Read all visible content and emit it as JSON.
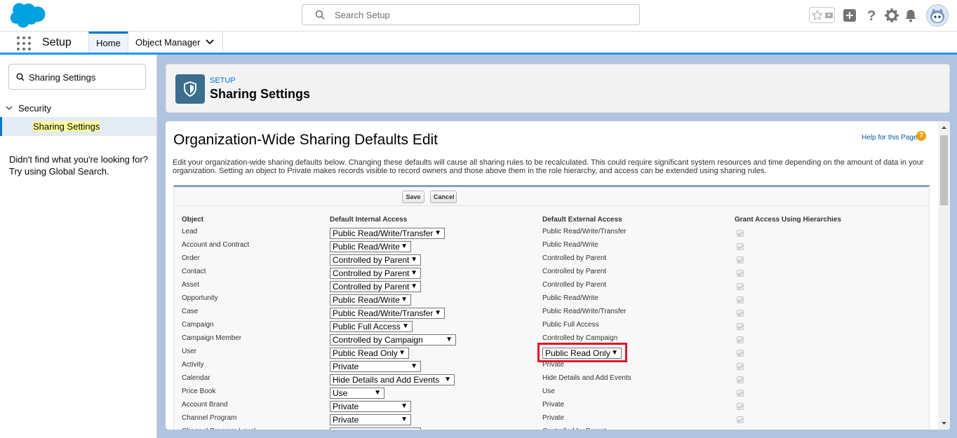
{
  "header": {
    "search_placeholder": "Search Setup",
    "icons": [
      "favorites-star-icon",
      "global-actions-plus-icon",
      "help-icon",
      "setup-gear-icon",
      "notifications-bell-icon",
      "user-avatar"
    ]
  },
  "nav": {
    "app_name": "Setup",
    "tabs": [
      {
        "label": "Home",
        "active": true
      },
      {
        "label": "Object Manager",
        "active": false
      }
    ]
  },
  "sidebar": {
    "quickfind_value": "Sharing Settings",
    "tree": {
      "node_label": "Security",
      "leaf_label": "Sharing Settings"
    },
    "not_found_line1": "Didn't find what you're looking for?",
    "not_found_line2": "Try using Global Search."
  },
  "page_header": {
    "eyebrow": "SETUP",
    "title": "Sharing Settings"
  },
  "content": {
    "heading": "Organization-Wide Sharing Defaults Edit",
    "help_link": "Help for this Page",
    "description": "Edit your organization-wide sharing defaults below. Changing these defaults will cause all sharing rules to be recalculated. This could require significant system resources and time depending on the amount of data in your organization. Setting an object to Private makes records visible to record owners and those above them in the role hierarchy, and access can be extended using sharing rules.",
    "buttons": {
      "save": "Save",
      "cancel": "Cancel"
    },
    "columns": {
      "object": "Object",
      "internal": "Default Internal Access",
      "external": "Default External Access",
      "hierarchies": "Grant Access Using Hierarchies"
    },
    "rows": [
      {
        "object": "Lead",
        "internal": "Public Read/Write/Transfer",
        "external": "Public Read/Write/Transfer"
      },
      {
        "object": "Account and Contract",
        "internal": "Public Read/Write",
        "external": "Public Read/Write"
      },
      {
        "object": "Order",
        "internal": "Controlled by Parent",
        "external": "Controlled by Parent"
      },
      {
        "object": "Contact",
        "internal": "Controlled by Parent",
        "external": "Controlled by Parent"
      },
      {
        "object": "Asset",
        "internal": "Controlled by Parent",
        "external": "Controlled by Parent"
      },
      {
        "object": "Opportunity",
        "internal": "Public Read/Write",
        "external": "Public Read/Write"
      },
      {
        "object": "Case",
        "internal": "Public Read/Write/Transfer",
        "external": "Public Read/Write/Transfer"
      },
      {
        "object": "Campaign",
        "internal": "Public Full Access",
        "external": "Public Full Access"
      },
      {
        "object": "Campaign Member",
        "internal": "Controlled by Campaign",
        "external": "Controlled by Campaign"
      },
      {
        "object": "User",
        "internal": "Public Read Only",
        "external": "Public Read Only"
      },
      {
        "object": "Activity",
        "internal": "Private",
        "external": "Private"
      },
      {
        "object": "Calendar",
        "internal": "Hide Details and Add Events",
        "external": "Hide Details and Add Events"
      },
      {
        "object": "Price Book",
        "internal": "Use",
        "external": "Use"
      },
      {
        "object": "Account Brand",
        "internal": "Private",
        "external": "Private"
      },
      {
        "object": "Channel Program",
        "internal": "Private",
        "external": "Private"
      },
      {
        "object": "Channel Program Level",
        "internal": "Controlled by Parent",
        "external": "Controlled by Parent"
      }
    ]
  },
  "colors": {
    "brand_blue": "#0176d3",
    "highlight_red": "#e0162b",
    "setup_icon_bg": "#3a6d8e"
  }
}
